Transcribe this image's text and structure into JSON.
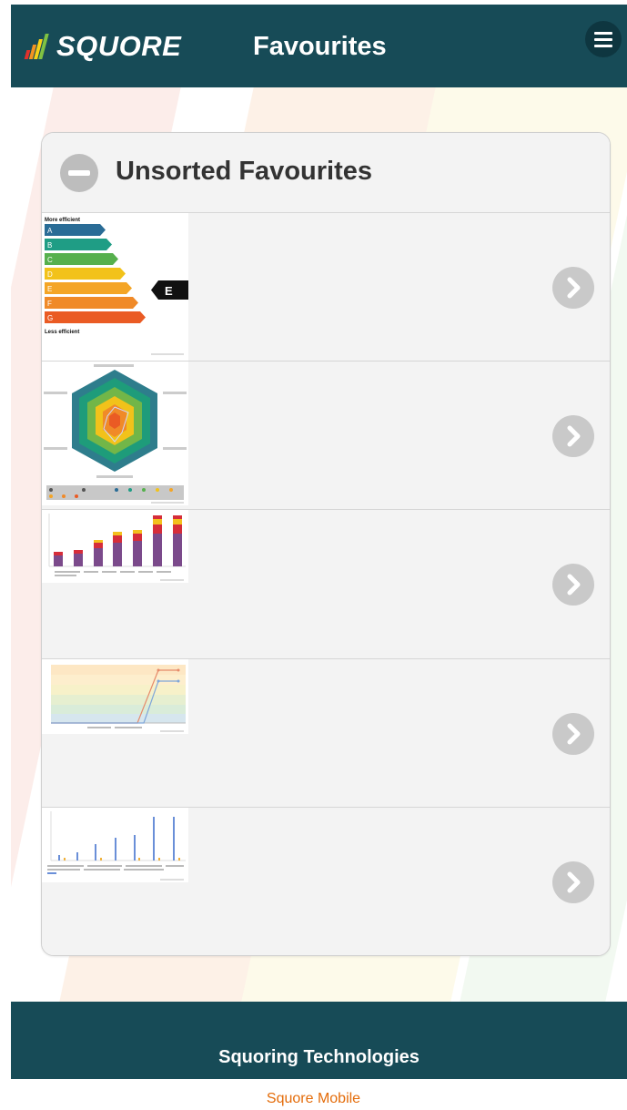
{
  "header": {
    "logo_text": "SQUORE",
    "title": "Favourites",
    "menu_icon": "hamburger-menu-icon"
  },
  "panel": {
    "title": "Unsorted Favourites",
    "collapse_icon": "minus-circle-icon",
    "items": [
      {
        "type": "energy-label-chart",
        "arrow_icon": "chevron-right-icon",
        "top_label": "More efficient",
        "bottom_label": "Less efficient",
        "ratings": [
          "A",
          "B",
          "C",
          "D",
          "E",
          "F",
          "G"
        ],
        "current": "E",
        "colors": [
          "#2a6c96",
          "#1f9d85",
          "#56b04d",
          "#f2c21a",
          "#f4a526",
          "#f08a28",
          "#ea5b24"
        ]
      },
      {
        "type": "radar-chart",
        "arrow_icon": "chevron-right-icon"
      },
      {
        "type": "stacked-bar-chart",
        "arrow_icon": "chevron-right-icon"
      },
      {
        "type": "line-chart",
        "arrow_icon": "chevron-right-icon"
      },
      {
        "type": "bar-chart",
        "arrow_icon": "chevron-right-icon"
      }
    ]
  },
  "footer": {
    "text": "Squoring Technologies"
  },
  "bottom_link": "Squore Mobile",
  "colors": {
    "header_bg": "#174b57",
    "accent": "#e46c0a"
  }
}
